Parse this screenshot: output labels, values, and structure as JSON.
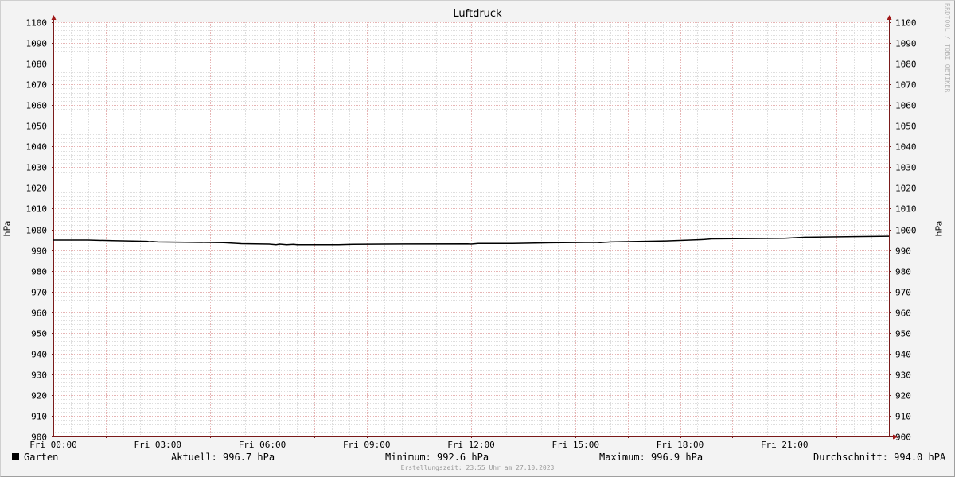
{
  "chart_data": {
    "type": "line",
    "title": "Luftdruck",
    "ylabel": "hPa",
    "ylim": [
      900,
      1100
    ],
    "y_ticks": [
      900,
      910,
      920,
      930,
      940,
      950,
      960,
      970,
      980,
      990,
      1000,
      1010,
      1020,
      1030,
      1040,
      1050,
      1060,
      1070,
      1080,
      1090,
      1100
    ],
    "x_range_hours": [
      0,
      24
    ],
    "x_ticks": [
      {
        "hour": 0,
        "label": "Fri 00:00"
      },
      {
        "hour": 3,
        "label": "Fri 03:00"
      },
      {
        "hour": 6,
        "label": "Fri 06:00"
      },
      {
        "hour": 9,
        "label": "Fri 09:00"
      },
      {
        "hour": 12,
        "label": "Fri 12:00"
      },
      {
        "hour": 15,
        "label": "Fri 15:00"
      },
      {
        "hour": 18,
        "label": "Fri 18:00"
      },
      {
        "hour": 21,
        "label": "Fri 21:00"
      }
    ],
    "grid": true,
    "legend_position": "bottom",
    "series": [
      {
        "name": "Garten",
        "color": "#000000",
        "x_hours": [
          0,
          1.0,
          1.7,
          2.7,
          2.75,
          2.85,
          3.0,
          4.9,
          5.4,
          6.2,
          6.4,
          6.5,
          6.7,
          6.9,
          7.0,
          8.2,
          8.6,
          9.5,
          11.9,
          12.0,
          12.2,
          13.2,
          14.3,
          15.6,
          15.7,
          16.0,
          17.6,
          18.6,
          18.7,
          18.9,
          21.0,
          21.6,
          23.0,
          24.0
        ],
        "values": [
          994.8,
          994.8,
          994.5,
          994.2,
          994.0,
          994.1,
          993.9,
          993.6,
          993.1,
          992.9,
          992.6,
          992.9,
          992.6,
          992.8,
          992.6,
          992.6,
          992.8,
          992.9,
          993.0,
          992.9,
          993.2,
          993.2,
          993.5,
          993.7,
          993.6,
          993.9,
          994.4,
          995.0,
          995.1,
          995.4,
          995.7,
          996.2,
          996.5,
          996.7
        ]
      }
    ]
  },
  "watermark": "RRDTOOL / TOBI OETIKER",
  "legend": {
    "series_label": "Garten",
    "current": "Aktuell: 996.7 hPa",
    "minimum": "Minimum: 992.6 hPa",
    "maximum": "Maximum: 996.9 hPa",
    "average": "Durchschnitt: 994.0 hPA"
  },
  "created_text": "Erstellungszeit: 23:55 Uhr am 27.10.2023"
}
